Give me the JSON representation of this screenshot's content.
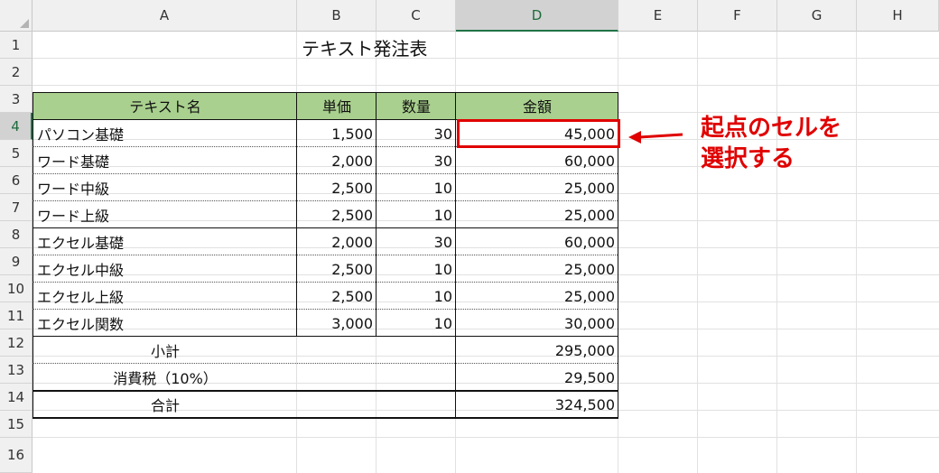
{
  "columns": [
    "A",
    "B",
    "C",
    "D",
    "E",
    "F",
    "G",
    "H"
  ],
  "rows": [
    "1",
    "2",
    "3",
    "4",
    "5",
    "6",
    "7",
    "8",
    "9",
    "10",
    "11",
    "12",
    "13",
    "14",
    "15",
    "16"
  ],
  "title": "テキスト発注表",
  "headers": {
    "name": "テキスト名",
    "price": "単価",
    "qty": "数量",
    "amount": "金額"
  },
  "items": [
    {
      "name": "パソコン基礎",
      "price": "1,500",
      "qty": "30",
      "amount": "45,000"
    },
    {
      "name": "ワード基礎",
      "price": "2,000",
      "qty": "30",
      "amount": "60,000"
    },
    {
      "name": "ワード中級",
      "price": "2,500",
      "qty": "10",
      "amount": "25,000"
    },
    {
      "name": "ワード上級",
      "price": "2,500",
      "qty": "10",
      "amount": "25,000"
    },
    {
      "name": "エクセル基礎",
      "price": "2,000",
      "qty": "30",
      "amount": "60,000"
    },
    {
      "name": "エクセル中級",
      "price": "2,500",
      "qty": "10",
      "amount": "25,000"
    },
    {
      "name": "エクセル上級",
      "price": "2,500",
      "qty": "10",
      "amount": "25,000"
    },
    {
      "name": "エクセル関数",
      "price": "3,000",
      "qty": "10",
      "amount": "30,000"
    }
  ],
  "totals": [
    {
      "label": "小計",
      "value": "295,000"
    },
    {
      "label": "消費税（10%）",
      "value": "29,500"
    },
    {
      "label": "合計",
      "value": "324,500"
    }
  ],
  "active_cell": "D4",
  "callout": {
    "line1": "起点のセルを",
    "line2": "選択する"
  },
  "colors": {
    "header_fill": "#a9d08e",
    "highlight": "#e00000",
    "excel_green": "#217346"
  }
}
